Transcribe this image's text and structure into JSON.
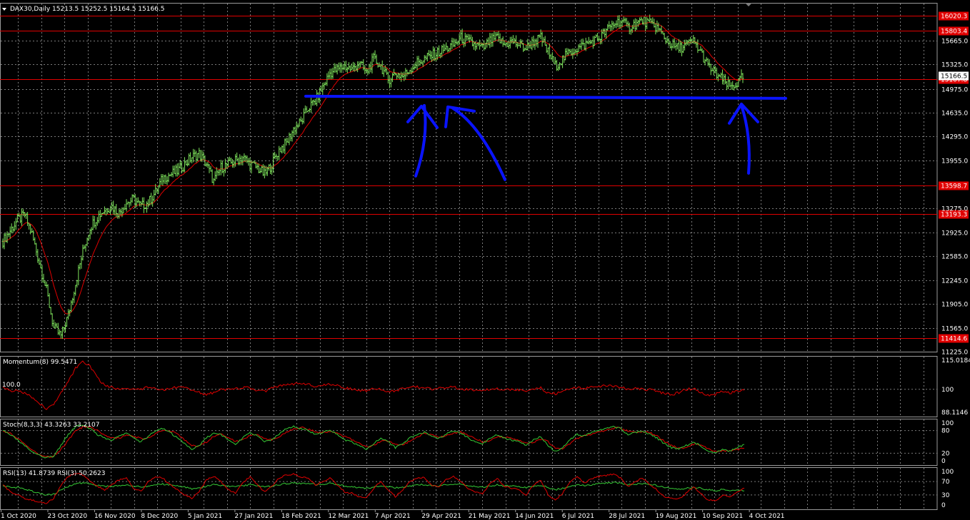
{
  "main_title": "DAX30,Daily  15213.5 15252.5 15164.5 15166.5",
  "panels": {
    "momentum": {
      "title": "Momentum(8) 99.5471",
      "ref_label": "100.0"
    },
    "stoch": {
      "title": "Stoch(8,3,3) 43.3263 33.2107"
    },
    "rsi": {
      "title": "RSI(13) 41.8739  RSI(3) 50.2623"
    }
  },
  "colors": {
    "background": "#000000",
    "grid": "#7a7a7a",
    "candle": "#7ee35c",
    "moving_average": "#e00000",
    "level_line": "#e00000",
    "annotation": "#0a14ff",
    "axis_text": "#ffffff",
    "price_label_bg": "#e00000"
  },
  "chart_data": [
    {
      "type": "candlestick",
      "name": "DAX30 Daily",
      "ylim": [
        11225,
        16120
      ],
      "y_ticks": [
        "15665.0",
        "15325.0",
        "14975.0",
        "14635.0",
        "14295.0",
        "13955.0",
        "13275.0",
        "12925.0",
        "12585.0",
        "12245.0",
        "11905.0",
        "11565.0",
        "11225.0"
      ],
      "x_ticks": [
        "1 Oct 2020",
        "23 Oct 2020",
        "16 Nov 2020",
        "8 Dec 2020",
        "5 Jan 2021",
        "27 Jan 2021",
        "18 Feb 2021",
        "12 Mar 2021",
        "7 Apr 2021",
        "29 Apr 2021",
        "21 May 2021",
        "14 Jun 2021",
        "6 Jul 2021",
        "28 Jul 2021",
        "19 Aug 2021",
        "10 Sep 2021",
        "4 Oct 2021"
      ],
      "horizontal_levels": [
        {
          "value": 16020.3,
          "label": "16020.3"
        },
        {
          "value": 15803.4,
          "label": "15803.4"
        },
        {
          "value": 15107.8,
          "label": "15107.8"
        },
        {
          "value": 13598.7,
          "label": "13598.7"
        },
        {
          "value": 13193.3,
          "label": "13193.3"
        },
        {
          "value": 11414.6,
          "label": "11414.6"
        }
      ],
      "current_price": {
        "value": 15166.5,
        "label": "15166.5"
      },
      "close_series": [
        12800,
        12950,
        13100,
        13180,
        12900,
        12500,
        12100,
        11560,
        11450,
        11750,
        12200,
        12650,
        13000,
        13150,
        13250,
        13300,
        13200,
        13350,
        13400,
        13300,
        13350,
        13500,
        13700,
        13750,
        13800,
        13900,
        14000,
        14050,
        13900,
        13650,
        13850,
        13900,
        13950,
        14000,
        13900,
        13850,
        13750,
        13900,
        14100,
        14200,
        14400,
        14500,
        14700,
        14800,
        15000,
        15200,
        15250,
        15300,
        15250,
        15350,
        15200,
        15400,
        15300,
        15100,
        15200,
        15150,
        15250,
        15350,
        15400,
        15450,
        15500,
        15550,
        15600,
        15700,
        15650,
        15600,
        15550,
        15650,
        15700,
        15600,
        15650,
        15600,
        15550,
        15650,
        15700,
        15500,
        15300,
        15400,
        15500,
        15550,
        15600,
        15650,
        15700,
        15800,
        15900,
        15950,
        15850,
        15900,
        15950,
        15900,
        15850,
        15700,
        15600,
        15550,
        15600,
        15650,
        15500,
        15300,
        15200,
        15100,
        15000,
        15050,
        15166
      ],
      "annotation": {
        "support_level": 14870
      }
    },
    {
      "type": "line",
      "name": "Momentum(8)",
      "ylim": [
        88.1146,
        115.0184
      ],
      "y_ticks": [
        "115.0184",
        "100",
        "88.1146"
      ],
      "reference": 100,
      "values": [
        100.5,
        99.5,
        99,
        98,
        96,
        93,
        90,
        92,
        98,
        104,
        111,
        114,
        112,
        106,
        102,
        101,
        100,
        100.5,
        99.8,
        100.2,
        101,
        100.4,
        99.6,
        100.3,
        101.2,
        100.8,
        99.5,
        98.5,
        97,
        98.5,
        100.2,
        99.8,
        100.3,
        101,
        100.6,
        99.4,
        99,
        100.5,
        101.5,
        102.2,
        102.8,
        103,
        102.4,
        101.5,
        102,
        102.5,
        101.8,
        100.6,
        100.2,
        99.6,
        99.2,
        100.4,
        99.8,
        98.6,
        99.3,
        100.4,
        100.9,
        101.2,
        100.6,
        100.2,
        100.4,
        100.8,
        101.1,
        100.4,
        99.8,
        99.6,
        99.2,
        100.2,
        100.5,
        99.8,
        100.1,
        99.6,
        98.9,
        100,
        100.6,
        98.2,
        97.6,
        99.4,
        100.3,
        100.8,
        100.4,
        100.9,
        101.3,
        102,
        101.6,
        101,
        100.2,
        100.5,
        100.1,
        99.7,
        98.9,
        97.8,
        97.2,
        98.4,
        99.8,
        100.4,
        98.6,
        96.8,
        97.4,
        98.8,
        98.2,
        99,
        99.55
      ]
    },
    {
      "type": "line",
      "name": "Stoch(8,3,3)",
      "ylim": [
        0,
        100
      ],
      "y_ticks": [
        "100",
        "80",
        "20",
        "0"
      ],
      "series": [
        {
          "name": "main",
          "values": [
            80,
            70,
            55,
            40,
            25,
            15,
            8,
            12,
            40,
            70,
            90,
            95,
            85,
            70,
            60,
            55,
            65,
            75,
            60,
            50,
            65,
            80,
            85,
            75,
            60,
            45,
            30,
            40,
            60,
            75,
            70,
            55,
            45,
            60,
            75,
            65,
            50,
            55,
            70,
            85,
            90,
            85,
            80,
            70,
            75,
            80,
            70,
            55,
            50,
            40,
            30,
            45,
            60,
            50,
            35,
            45,
            60,
            70,
            75,
            65,
            60,
            70,
            80,
            75,
            60,
            50,
            45,
            60,
            70,
            60,
            55,
            50,
            40,
            55,
            65,
            40,
            25,
            35,
            55,
            70,
            65,
            75,
            80,
            85,
            90,
            85,
            70,
            75,
            80,
            70,
            60,
            45,
            35,
            30,
            40,
            50,
            40,
            25,
            20,
            30,
            25,
            35,
            43.3
          ]
        },
        {
          "name": "signal",
          "values": [
            78,
            72,
            60,
            45,
            30,
            18,
            10,
            12,
            30,
            55,
            78,
            90,
            90,
            80,
            68,
            60,
            60,
            68,
            65,
            58,
            60,
            72,
            80,
            80,
            70,
            55,
            40,
            38,
            50,
            65,
            70,
            62,
            52,
            55,
            68,
            68,
            58,
            55,
            62,
            75,
            85,
            88,
            84,
            76,
            74,
            77,
            74,
            64,
            56,
            46,
            36,
            40,
            52,
            52,
            42,
            42,
            52,
            63,
            72,
            70,
            64,
            66,
            74,
            76,
            68,
            58,
            50,
            54,
            64,
            63,
            58,
            53,
            46,
            49,
            58,
            50,
            35,
            32,
            45,
            60,
            66,
            70,
            76,
            81,
            86,
            87,
            78,
            75,
            78,
            74,
            65,
            52,
            40,
            33,
            36,
            44,
            43,
            32,
            24,
            26,
            26,
            30,
            33.2
          ]
        }
      ]
    },
    {
      "type": "line",
      "name": "RSI",
      "ylim": [
        0,
        100
      ],
      "y_ticks": [
        "100",
        "70",
        "30",
        "0"
      ],
      "series": [
        {
          "name": "RSI(13)",
          "values": [
            55,
            54,
            52,
            48,
            42,
            36,
            30,
            32,
            45,
            55,
            63,
            66,
            62,
            58,
            56,
            55,
            57,
            60,
            56,
            54,
            57,
            61,
            62,
            60,
            57,
            53,
            48,
            50,
            56,
            60,
            59,
            56,
            54,
            57,
            61,
            58,
            55,
            56,
            60,
            64,
            66,
            65,
            64,
            61,
            62,
            64,
            61,
            57,
            55,
            52,
            50,
            53,
            57,
            55,
            51,
            53,
            57,
            60,
            61,
            59,
            57,
            60,
            62,
            61,
            58,
            55,
            54,
            57,
            60,
            57,
            56,
            55,
            52,
            56,
            59,
            52,
            46,
            50,
            56,
            60,
            58,
            61,
            63,
            65,
            67,
            65,
            61,
            62,
            63,
            61,
            58,
            53,
            50,
            48,
            50,
            53,
            50,
            45,
            43,
            46,
            44,
            47,
            41.9
          ]
        },
        {
          "name": "RSI(3)",
          "values": [
            60,
            40,
            30,
            20,
            15,
            10,
            5,
            20,
            60,
            85,
            95,
            90,
            70,
            55,
            45,
            60,
            75,
            80,
            50,
            40,
            70,
            85,
            80,
            60,
            45,
            30,
            20,
            40,
            75,
            85,
            70,
            45,
            35,
            65,
            85,
            60,
            40,
            55,
            80,
            90,
            92,
            85,
            80,
            60,
            70,
            80,
            60,
            40,
            35,
            25,
            20,
            50,
            70,
            45,
            25,
            45,
            70,
            80,
            82,
            60,
            55,
            75,
            85,
            70,
            50,
            40,
            35,
            65,
            80,
            55,
            50,
            45,
            30,
            60,
            75,
            30,
            15,
            35,
            70,
            85,
            65,
            80,
            85,
            88,
            92,
            80,
            55,
            70,
            80,
            60,
            45,
            25,
            20,
            18,
            35,
            55,
            35,
            15,
            12,
            30,
            25,
            40,
            50.3
          ]
        }
      ]
    }
  ]
}
